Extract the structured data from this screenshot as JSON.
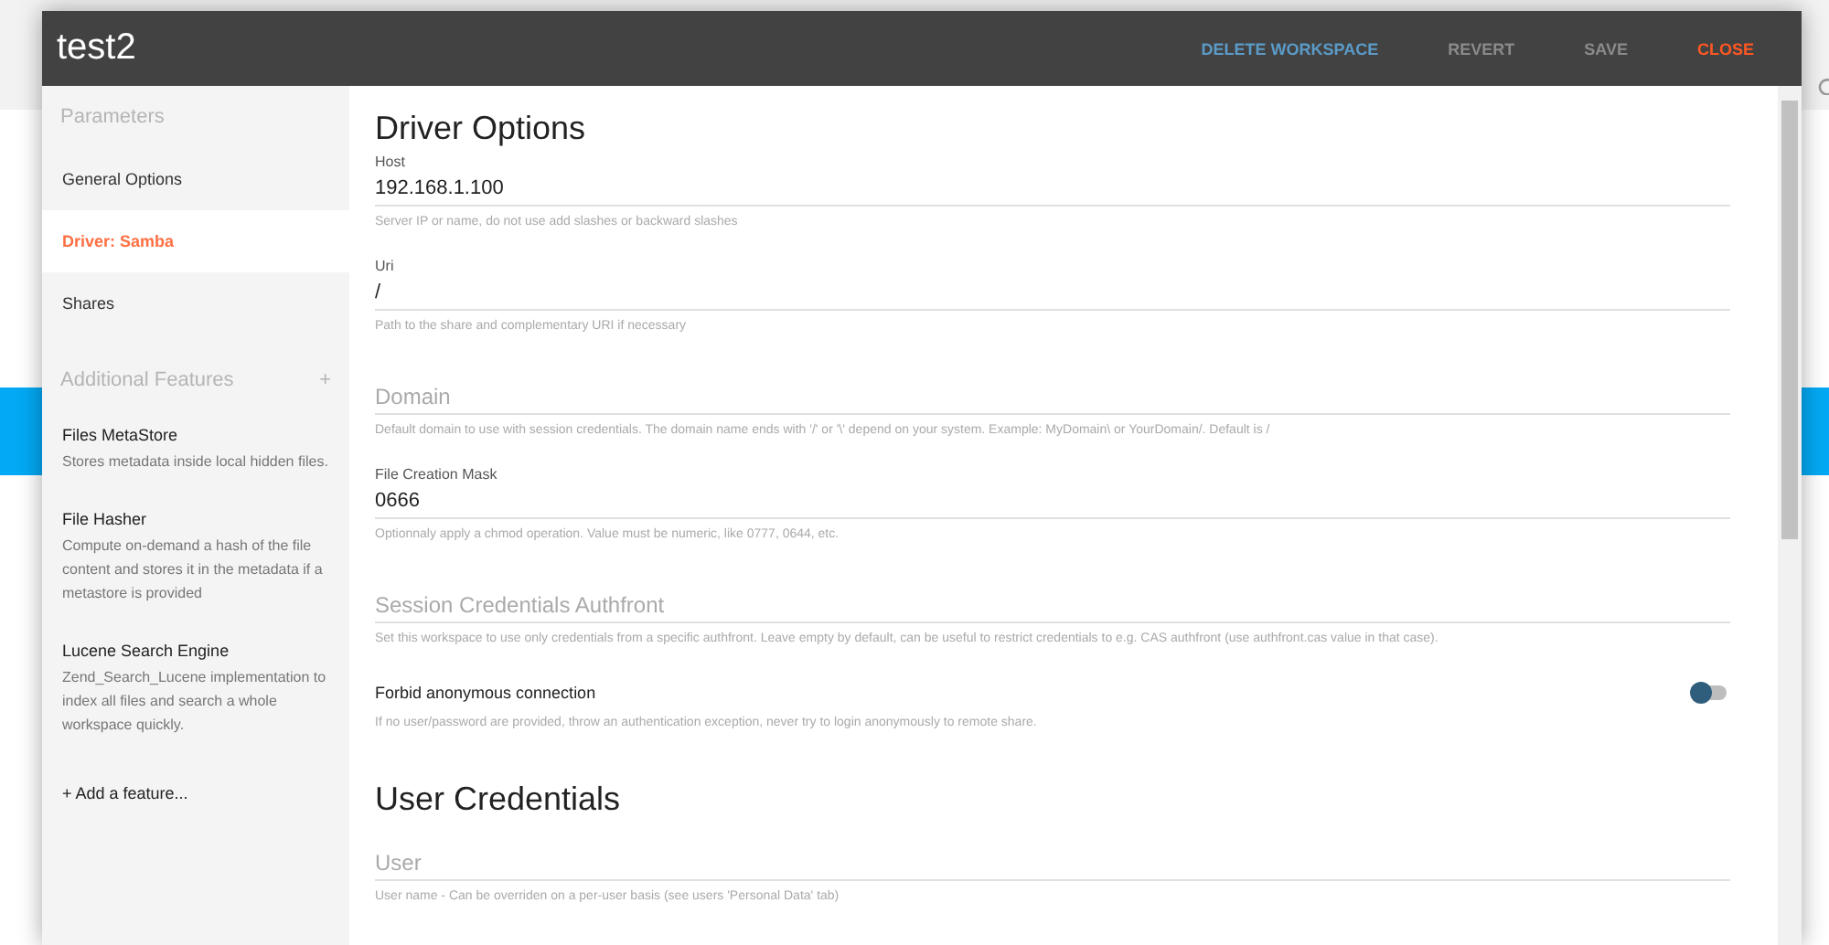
{
  "window": {
    "title": "test2"
  },
  "actions": [
    {
      "label": "DELETE WORKSPACE",
      "color": "#5b9bc8"
    },
    {
      "label": "REVERT",
      "color": "#8a8a8a"
    },
    {
      "label": "SAVE",
      "color": "#8a8a8a"
    },
    {
      "label": "CLOSE",
      "color": "#ff5722"
    }
  ],
  "sidebar": {
    "parameters_title": "Parameters",
    "items": [
      {
        "label": "General Options",
        "selected": false
      },
      {
        "label": "Driver: Samba",
        "selected": true
      },
      {
        "label": "Shares",
        "selected": false
      }
    ],
    "features_title": "Additional Features",
    "features_add_icon": "+",
    "features": [
      {
        "title": "Files MetaStore",
        "description": "Stores metadata inside local hidden files."
      },
      {
        "title": "File Hasher",
        "description": "Compute on-demand a hash of the file content and stores it in the metadata if a metastore is provided"
      },
      {
        "title": "Lucene Search Engine",
        "description": "Zend_Search_Lucene implementation to index all files and search a whole workspace quickly."
      }
    ],
    "add_feature": "+ Add a feature..."
  },
  "sections": [
    {
      "heading": "Driver Options",
      "fields": [
        {
          "kind": "text",
          "label": "Host",
          "value": "192.168.1.100",
          "help": "Server IP or name, do not use add slashes or backward slashes"
        },
        {
          "kind": "text",
          "label": "Uri",
          "value": "/",
          "help": "Path to the share and complementary URI if necessary"
        },
        {
          "kind": "text",
          "placeholder": "Domain",
          "help": "Default domain to use with session credentials. The domain name ends with '/' or '\\' depend on your system. Example: MyDomain\\ or YourDomain/. Default is /"
        },
        {
          "kind": "text",
          "label": "File Creation Mask",
          "value": "0666",
          "help": "Optionnaly apply a chmod operation. Value must be numeric, like 0777, 0644, etc."
        },
        {
          "kind": "text",
          "placeholder": "Session Credentials Authfront",
          "help": "Set this workspace to use only credentials from a specific authfront. Leave empty by default, can be useful to restrict credentials to e.g. CAS authfront (use authfront.cas value in that case)."
        },
        {
          "kind": "toggle",
          "label": "Forbid anonymous connection",
          "on": false,
          "help": "If no user/password are provided, throw an authentication exception, never try to login anonymously to remote share."
        }
      ]
    },
    {
      "heading": "User Credentials",
      "fields": [
        {
          "kind": "text",
          "placeholder": "User",
          "help": "User name - Can be overriden on a per-user basis (see users 'Personal Data' tab)"
        }
      ]
    }
  ]
}
